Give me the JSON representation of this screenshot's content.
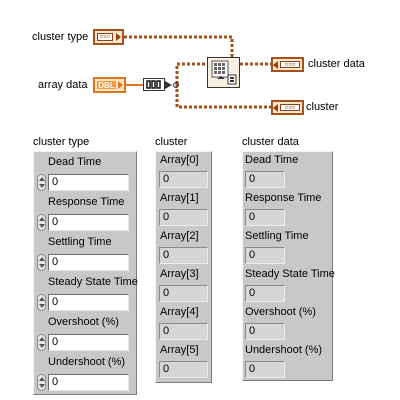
{
  "block_diagram": {
    "cluster_type_label": "cluster type",
    "array_data_label": "array data",
    "cluster_data_label": "cluster data",
    "cluster_label": "cluster",
    "cluster_terminal_glyph": "▫▫▫",
    "dbl_glyph": "DBL",
    "build_array_glyph": "[ ]"
  },
  "front_panel": {
    "cluster_type": {
      "title": "cluster type",
      "elements": [
        {
          "label": "Dead Time",
          "value": "0"
        },
        {
          "label": "Response Time",
          "value": "0"
        },
        {
          "label": "Settling Time",
          "value": "0"
        },
        {
          "label": "Steady State Time",
          "value": "0"
        },
        {
          "label": "Overshoot (%)",
          "value": "0"
        },
        {
          "label": "Undershoot (%)",
          "value": "0"
        }
      ]
    },
    "cluster": {
      "title": "cluster",
      "elements": [
        {
          "label": "Array[0]",
          "value": "0"
        },
        {
          "label": "Array[1]",
          "value": "0"
        },
        {
          "label": "Array[2]",
          "value": "0"
        },
        {
          "label": "Array[3]",
          "value": "0"
        },
        {
          "label": "Array[4]",
          "value": "0"
        },
        {
          "label": "Array[5]",
          "value": "0"
        }
      ]
    },
    "cluster_data": {
      "title": "cluster data",
      "elements": [
        {
          "label": "Dead Time",
          "value": "0"
        },
        {
          "label": "Response Time",
          "value": "0"
        },
        {
          "label": "Settling Time",
          "value": "0"
        },
        {
          "label": "Steady State Time",
          "value": "0"
        },
        {
          "label": "Overshoot (%)",
          "value": "0"
        },
        {
          "label": "Undershoot (%)",
          "value": "0"
        }
      ]
    }
  },
  "colors": {
    "cluster_wire": "#a4511c",
    "dbl_wire": "#e0761b",
    "panel_gray": "#c8c8c8"
  }
}
